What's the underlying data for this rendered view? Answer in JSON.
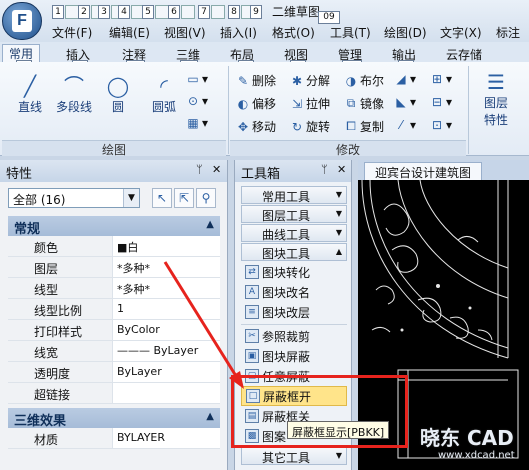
{
  "app": {
    "logo_letter": "F",
    "doc_title": "二维草图",
    "title_badge": "09"
  },
  "quick_access": [
    "1",
    "2",
    "3",
    "4",
    "5",
    "6",
    "7",
    "8",
    "9"
  ],
  "menu": [
    "文件(F)",
    "编辑(E)",
    "视图(V)",
    "插入(I)",
    "格式(O)",
    "工具(T)",
    "绘图(D)",
    "文字(X)",
    "标注"
  ],
  "ribbon_tabs": [
    {
      "label": "常用",
      "key": "H",
      "active": true
    },
    {
      "label": "插入",
      "key": "IN"
    },
    {
      "label": "注释",
      "key": "AN"
    },
    {
      "label": "三维",
      "key": "TD"
    },
    {
      "label": "布局",
      "key": "L"
    },
    {
      "label": "视图",
      "key": "VI"
    },
    {
      "label": "管理",
      "key": "MA"
    },
    {
      "label": "输出",
      "key": "O"
    },
    {
      "label": "云存储"
    }
  ],
  "ribbon": {
    "draw": {
      "line": "直线",
      "polyline": "多段线",
      "circle": "圆",
      "arc": "圆弧",
      "group_label": "绘图"
    },
    "modify": {
      "erase": "删除",
      "explode": "分解",
      "boolean": "布尔",
      "offset": "偏移",
      "stretch": "拉伸",
      "mirror": "镜像",
      "move": "移动",
      "rotate": "旋转",
      "copy": "复制",
      "group_label": "修改"
    },
    "layer": {
      "label": "图层",
      "label2": "特性"
    }
  },
  "properties": {
    "title": "特性",
    "filter": "全部 (16)",
    "sections": {
      "general": "常规",
      "three_d": "三维效果"
    },
    "rows": [
      {
        "key": "颜色",
        "value": "■白"
      },
      {
        "key": "图层",
        "value": "*多种*"
      },
      {
        "key": "线型",
        "value": "*多种*"
      },
      {
        "key": "线型比例",
        "value": "1"
      },
      {
        "key": "打印样式",
        "value": "ByColor"
      },
      {
        "key": "线宽",
        "value": "——— ByLayer"
      },
      {
        "key": "透明度",
        "value": "ByLayer"
      },
      {
        "key": "超链接",
        "value": ""
      }
    ],
    "material": {
      "key": "材质",
      "value": "BYLAYER"
    }
  },
  "toolbox": {
    "title": "工具箱",
    "categories": [
      "常用工具",
      "图层工具",
      "曲线工具",
      "图块工具"
    ],
    "items": [
      "图块转化",
      "图块改名",
      "图块改层",
      "参照裁剪",
      "图块屏蔽",
      "任意屏蔽",
      "屏蔽框开",
      "屏蔽框关",
      "图案"
    ],
    "bottom_category": "其它工具"
  },
  "drawing": {
    "tab": "迎宾台设计建筑图"
  },
  "tooltip": "屏蔽框显示[PBKK]",
  "watermark": {
    "logo": "晓东 CAD",
    "url": "www.xdcad.net"
  }
}
